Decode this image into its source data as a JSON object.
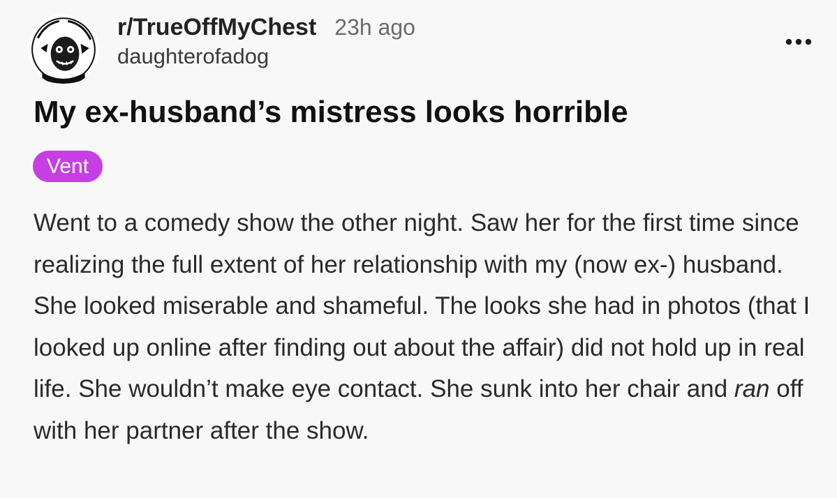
{
  "post": {
    "subreddit": "r/TrueOffMyChest",
    "time_ago": "23h ago",
    "username": "daughterofadog",
    "title": "My ex-husband’s mistress looks horrible",
    "flair": {
      "label": "Vent",
      "color": "#c63fe3"
    },
    "body": {
      "text_before_emphasis": "Went to a comedy show the other night. Saw her for the first time since realizing the full extent of her relationship with my (now ex-) husband. She looked miserable and shameful. The looks she had in photos (that I looked up online after finding out about the affair) did not hold up in real life. She wouldn’t make eye contact. She sunk into her chair and ",
      "emphasis": "ran",
      "text_after_emphasis": " off with her partner after the show."
    }
  },
  "icons": {
    "avatar": "subreddit-avatar-icon",
    "overflow_menu": "more-options-icon"
  },
  "colors": {
    "background": "#f8f8f8",
    "flair": "#c63fe3",
    "meta_gray": "#6b6b6b"
  }
}
